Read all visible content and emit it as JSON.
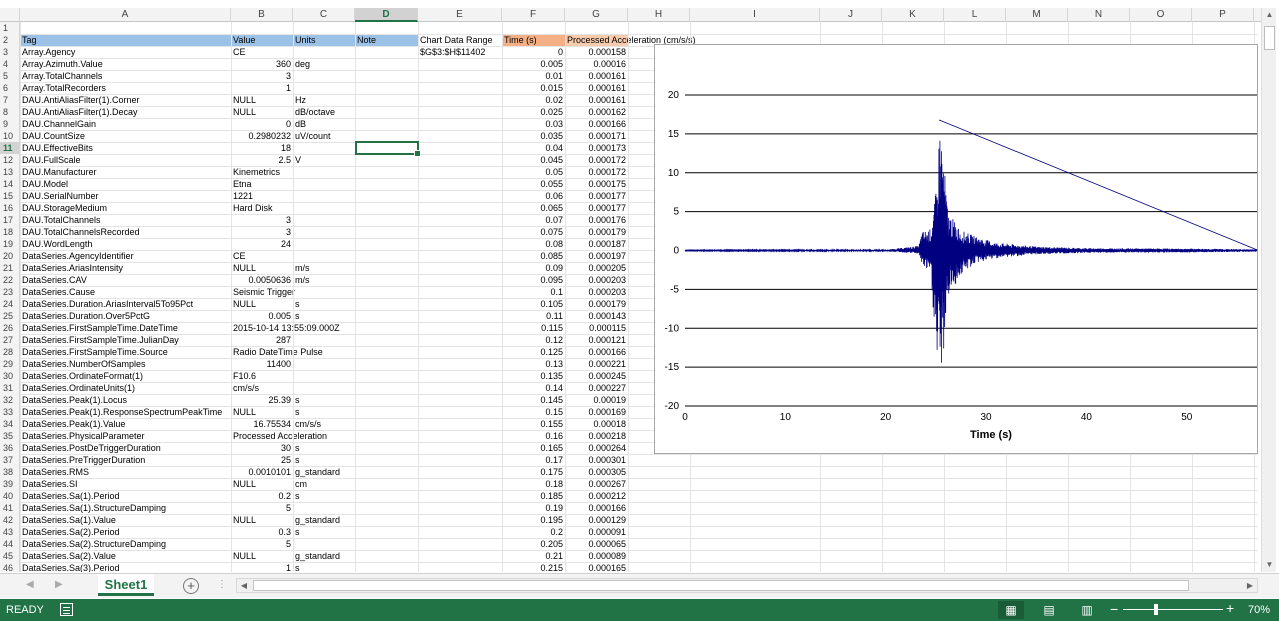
{
  "columns": [
    "A",
    "B",
    "C",
    "D",
    "E",
    "F",
    "G",
    "H",
    "I",
    "J",
    "K",
    "L",
    "M",
    "N",
    "O",
    "P"
  ],
  "active_column": "D",
  "active_row": "11",
  "header_row": {
    "num": "2",
    "a": "Tag",
    "b": "Value",
    "c": "Units",
    "d": "Note",
    "e": "Chart Data Range",
    "f": "Time (s)",
    "g": "Processed Acceleration (cm/s/s)"
  },
  "row3_extra": {
    "e": "$G$3:$H$11402"
  },
  "rows": [
    {
      "n": "3",
      "a": "Array.Agency",
      "b": "CE",
      "b_num": false,
      "c": "",
      "f": "0",
      "g": "0.000158"
    },
    {
      "n": "4",
      "a": "Array.Azimuth.Value",
      "b": "360",
      "b_num": true,
      "c": "deg",
      "f": "0.005",
      "g": "0.00016"
    },
    {
      "n": "5",
      "a": "Array.TotalChannels",
      "b": "3",
      "b_num": true,
      "c": "",
      "f": "0.01",
      "g": "0.000161"
    },
    {
      "n": "6",
      "a": "Array.TotalRecorders",
      "b": "1",
      "b_num": true,
      "c": "",
      "f": "0.015",
      "g": "0.000161"
    },
    {
      "n": "7",
      "a": "DAU.AntiAliasFilter(1).Corner",
      "b": "NULL",
      "b_num": false,
      "c": "Hz",
      "f": "0.02",
      "g": "0.000161"
    },
    {
      "n": "8",
      "a": "DAU.AntiAliasFilter(1).Decay",
      "b": "NULL",
      "b_num": false,
      "c": "dB/octave",
      "f": "0.025",
      "g": "0.000162"
    },
    {
      "n": "9",
      "a": "DAU.ChannelGain",
      "b": "0",
      "b_num": true,
      "c": "dB",
      "f": "0.03",
      "g": "0.000166"
    },
    {
      "n": "10",
      "a": "DAU.CountSize",
      "b": "0.2980232",
      "b_num": true,
      "c": "uV/count",
      "f": "0.035",
      "g": "0.000171"
    },
    {
      "n": "11",
      "a": "DAU.EffectiveBits",
      "b": "18",
      "b_num": true,
      "c": "",
      "f": "0.04",
      "g": "0.000173"
    },
    {
      "n": "12",
      "a": "DAU.FullScale",
      "b": "2.5",
      "b_num": true,
      "c": "V",
      "f": "0.045",
      "g": "0.000172"
    },
    {
      "n": "13",
      "a": "DAU.Manufacturer",
      "b": "Kinemetrics",
      "b_num": false,
      "c": "",
      "f": "0.05",
      "g": "0.000172"
    },
    {
      "n": "14",
      "a": "DAU.Model",
      "b": "Etna",
      "b_num": false,
      "c": "",
      "f": "0.055",
      "g": "0.000175"
    },
    {
      "n": "15",
      "a": "DAU.SerialNumber",
      "b": "1221",
      "b_num": false,
      "c": "",
      "f": "0.06",
      "g": "0.000177"
    },
    {
      "n": "16",
      "a": "DAU.StorageMedium",
      "b": "Hard Disk",
      "b_num": false,
      "c": "",
      "f": "0.065",
      "g": "0.000177"
    },
    {
      "n": "17",
      "a": "DAU.TotalChannels",
      "b": "3",
      "b_num": true,
      "c": "",
      "f": "0.07",
      "g": "0.000176"
    },
    {
      "n": "18",
      "a": "DAU.TotalChannelsRecorded",
      "b": "3",
      "b_num": true,
      "c": "",
      "f": "0.075",
      "g": "0.000179"
    },
    {
      "n": "19",
      "a": "DAU.WordLength",
      "b": "24",
      "b_num": true,
      "c": "",
      "f": "0.08",
      "g": "0.000187"
    },
    {
      "n": "20",
      "a": "DataSeries.AgencyIdentifier",
      "b": "CE",
      "b_num": false,
      "c": "",
      "f": "0.085",
      "g": "0.000197"
    },
    {
      "n": "21",
      "a": "DataSeries.AriasIntensity",
      "b": "NULL",
      "b_num": false,
      "c": "m/s",
      "f": "0.09",
      "g": "0.000205"
    },
    {
      "n": "22",
      "a": "DataSeries.CAV",
      "b": "0.0050636",
      "b_num": true,
      "c": "m/s",
      "f": "0.095",
      "g": "0.000203"
    },
    {
      "n": "23",
      "a": "DataSeries.Cause",
      "b": "Seismic Trigger",
      "b_num": false,
      "c": "",
      "f": "0.1",
      "g": "0.000203"
    },
    {
      "n": "24",
      "a": "DataSeries.Duration.AriasInterval5To95Pct",
      "b": "NULL",
      "b_num": false,
      "c": "s",
      "f": "0.105",
      "g": "0.000179"
    },
    {
      "n": "25",
      "a": "DataSeries.Duration.Over5PctG",
      "b": "0.005",
      "b_num": true,
      "c": "s",
      "f": "0.11",
      "g": "0.000143"
    },
    {
      "n": "26",
      "a": "DataSeries.FirstSampleTime.DateTime",
      "b": "2015-10-14 13:55:09.000Z",
      "b_num": false,
      "c": "",
      "f": "0.115",
      "g": "0.000115"
    },
    {
      "n": "27",
      "a": "DataSeries.FirstSampleTime.JulianDay",
      "b": "287",
      "b_num": true,
      "c": "",
      "f": "0.12",
      "g": "0.000121"
    },
    {
      "n": "28",
      "a": "DataSeries.FirstSampleTime.Source",
      "b": "Radio DateTime Pulse",
      "b_num": false,
      "c": "",
      "f": "0.125",
      "g": "0.000166"
    },
    {
      "n": "29",
      "a": "DataSeries.NumberOfSamples",
      "b": "11400",
      "b_num": true,
      "c": "",
      "f": "0.13",
      "g": "0.000221"
    },
    {
      "n": "30",
      "a": "DataSeries.OrdinateFormat(1)",
      "b": "F10.6",
      "b_num": false,
      "c": "",
      "f": "0.135",
      "g": "0.000245"
    },
    {
      "n": "31",
      "a": "DataSeries.OrdinateUnits(1)",
      "b": "cm/s/s",
      "b_num": false,
      "c": "",
      "f": "0.14",
      "g": "0.000227"
    },
    {
      "n": "32",
      "a": "DataSeries.Peak(1).Locus",
      "b": "25.39",
      "b_num": true,
      "c": "s",
      "f": "0.145",
      "g": "0.00019"
    },
    {
      "n": "33",
      "a": "DataSeries.Peak(1).ResponseSpectrumPeakTime",
      "b": "NULL",
      "b_num": false,
      "c": "s",
      "f": "0.15",
      "g": "0.000169"
    },
    {
      "n": "34",
      "a": "DataSeries.Peak(1).Value",
      "b": "16.75534",
      "b_num": true,
      "c": "cm/s/s",
      "f": "0.155",
      "g": "0.00018"
    },
    {
      "n": "35",
      "a": "DataSeries.PhysicalParameter",
      "b": "Processed Acceleration",
      "b_num": false,
      "c": "",
      "f": "0.16",
      "g": "0.000218"
    },
    {
      "n": "36",
      "a": "DataSeries.PostDeTriggerDuration",
      "b": "30",
      "b_num": true,
      "c": "s",
      "f": "0.165",
      "g": "0.000264"
    },
    {
      "n": "37",
      "a": "DataSeries.PreTriggerDuration",
      "b": "25",
      "b_num": true,
      "c": "s",
      "f": "0.17",
      "g": "0.000301"
    },
    {
      "n": "38",
      "a": "DataSeries.RMS",
      "b": "0.0010101",
      "b_num": true,
      "c": "g_standard",
      "f": "0.175",
      "g": "0.000305"
    },
    {
      "n": "39",
      "a": "DataSeries.SI",
      "b": "NULL",
      "b_num": false,
      "c": "cm",
      "f": "0.18",
      "g": "0.000267"
    },
    {
      "n": "40",
      "a": "DataSeries.Sa(1).Period",
      "b": "0.2",
      "b_num": true,
      "c": "s",
      "f": "0.185",
      "g": "0.000212"
    },
    {
      "n": "41",
      "a": "DataSeries.Sa(1).StructureDamping",
      "b": "5",
      "b_num": true,
      "c": "",
      "f": "0.19",
      "g": "0.000166"
    },
    {
      "n": "42",
      "a": "DataSeries.Sa(1).Value",
      "b": "NULL",
      "b_num": false,
      "c": "g_standard",
      "f": "0.195",
      "g": "0.000129"
    },
    {
      "n": "43",
      "a": "DataSeries.Sa(2).Period",
      "b": "0.3",
      "b_num": true,
      "c": "s",
      "f": "0.2",
      "g": "0.000091"
    },
    {
      "n": "44",
      "a": "DataSeries.Sa(2).StructureDamping",
      "b": "5",
      "b_num": true,
      "c": "",
      "f": "0.205",
      "g": "0.000065"
    },
    {
      "n": "45",
      "a": "DataSeries.Sa(2).Value",
      "b": "NULL",
      "b_num": false,
      "c": "g_standard",
      "f": "0.21",
      "g": "0.000089"
    },
    {
      "n": "46",
      "a": "DataSeries.Sa(3).Period",
      "b": "1",
      "b_num": true,
      "c": "s",
      "f": "0.215",
      "g": "0.000165"
    }
  ],
  "sheet_tab": "Sheet1",
  "status": {
    "ready": "READY",
    "zoom": "70%",
    "zoom_percent": 70
  },
  "chart_data": {
    "type": "line",
    "title": "",
    "xlabel": "Time  (s)",
    "ylabel": "",
    "xlim": [
      0,
      57
    ],
    "ylim": [
      -20,
      20
    ],
    "xticks": [
      0,
      10,
      20,
      30,
      40,
      50
    ],
    "yticks": [
      20,
      15,
      10,
      5,
      0,
      -5,
      -10,
      -15,
      -20
    ],
    "grid": "horizontal",
    "series_color": "#000080",
    "envelope": [
      {
        "x": 0,
        "min": -0.05,
        "max": 0.05
      },
      {
        "x": 10,
        "min": -0.08,
        "max": 0.08
      },
      {
        "x": 20,
        "min": -0.1,
        "max": 0.1
      },
      {
        "x": 23.3,
        "min": -0.4,
        "max": 0.6
      },
      {
        "x": 23.6,
        "min": -1.8,
        "max": 2.4
      },
      {
        "x": 24.5,
        "min": -3.2,
        "max": 2.8
      },
      {
        "x": 25.1,
        "min": -15.0,
        "max": 8.5
      },
      {
        "x": 25.39,
        "min": -16.0,
        "max": 16.76
      },
      {
        "x": 25.7,
        "min": -14.5,
        "max": 13.0
      },
      {
        "x": 26.2,
        "min": -6.0,
        "max": 5.0
      },
      {
        "x": 27.5,
        "min": -3.2,
        "max": 2.6
      },
      {
        "x": 29.0,
        "min": -1.6,
        "max": 1.8
      },
      {
        "x": 31.0,
        "min": -1.0,
        "max": 1.0
      },
      {
        "x": 35.0,
        "min": -0.5,
        "max": 0.5
      },
      {
        "x": 40.0,
        "min": -0.3,
        "max": 0.3
      },
      {
        "x": 50.0,
        "min": -0.25,
        "max": 0.25
      },
      {
        "x": 57.0,
        "min": -0.15,
        "max": 0.15
      }
    ],
    "peak": {
      "x": 25.39,
      "y": 16.75534
    }
  }
}
